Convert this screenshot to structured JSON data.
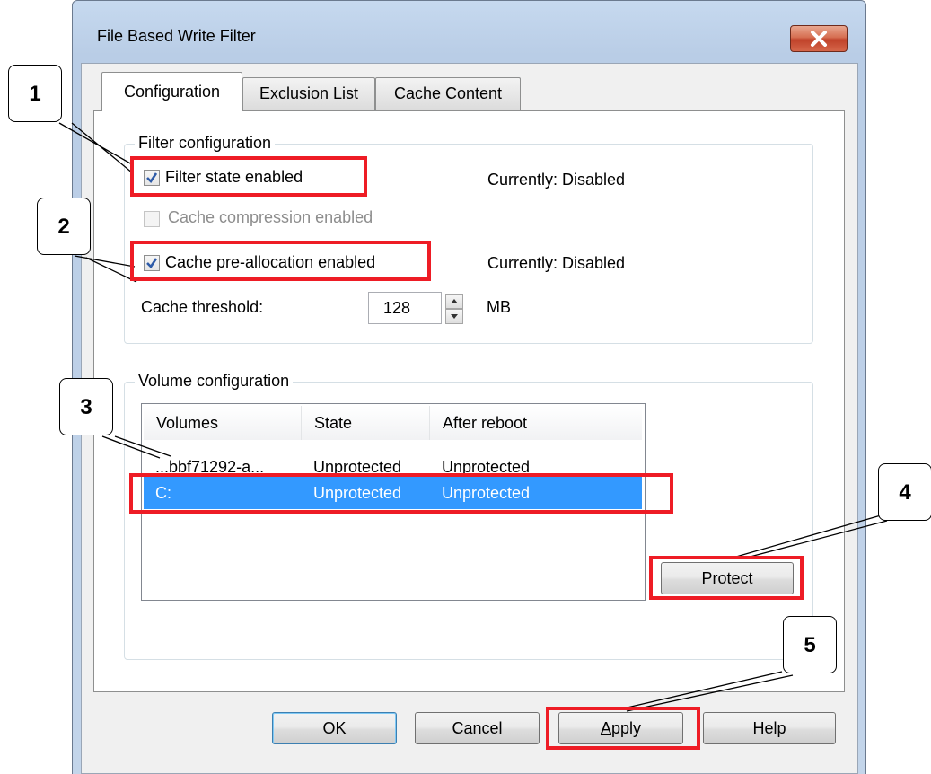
{
  "window": {
    "title": "File Based Write Filter"
  },
  "tabs": [
    {
      "label": "Configuration",
      "active": true
    },
    {
      "label": "Exclusion List",
      "active": false
    },
    {
      "label": "Cache Content",
      "active": false
    }
  ],
  "filter_group": {
    "legend": "Filter configuration",
    "filter_state": {
      "label": "Filter state enabled",
      "checked": true,
      "status": "Currently: Disabled"
    },
    "cache_compression": {
      "label": "Cache compression enabled",
      "checked": false,
      "disabled": true
    },
    "cache_preallocation": {
      "label": "Cache pre-allocation enabled",
      "checked": true,
      "status": "Currently: Disabled"
    },
    "cache_threshold": {
      "label": "Cache threshold:",
      "value": "128",
      "unit": "MB"
    }
  },
  "volume_group": {
    "legend": "Volume configuration",
    "columns": [
      "Volumes",
      "State",
      "After reboot"
    ],
    "rows": [
      {
        "volume": "...bbf71292-a...",
        "state": "Unprotected",
        "after_reboot": "Unprotected",
        "selected": false
      },
      {
        "volume": "C:",
        "state": "Unprotected",
        "after_reboot": "Unprotected",
        "selected": true
      }
    ],
    "protect_button": "Protect",
    "protect_mnemonic": "P",
    "protect_rest": "rotect"
  },
  "buttons": {
    "ok": "OK",
    "cancel": "Cancel",
    "apply_mnemonic": "A",
    "apply_rest": "pply",
    "help": "Help"
  },
  "annotations": [
    "1",
    "2",
    "3",
    "4",
    "5"
  ],
  "colors": {
    "highlight": "#ee1c25",
    "selection": "#3399ff"
  }
}
